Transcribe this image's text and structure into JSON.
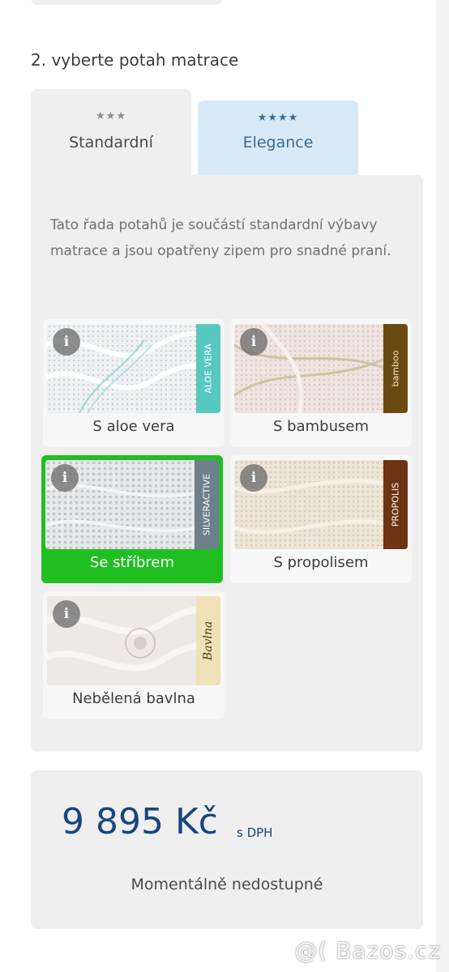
{
  "heading": "2. vyberte potah matrace",
  "tabs": [
    {
      "label": "Standardní",
      "stars": "★★★",
      "star_color": "#8b8b8b"
    },
    {
      "label": "Elegance",
      "stars": "★★★★",
      "star_color": "#3d6b90"
    }
  ],
  "description": "Tato řada potahů je součástí standardní výbavy matrace a jsou opatřeny zipem pro snadné praní.",
  "covers": [
    {
      "label": "S aloe vera",
      "brand": "ALOE VERA",
      "brand_color": "#57c9c0",
      "info": "i",
      "selected": false
    },
    {
      "label": "S bambusem",
      "brand": "bamboo",
      "brand_color": "#6b4a12",
      "info": "i",
      "selected": false
    },
    {
      "label": "Se stříbrem",
      "brand": "SILVERACTIVE",
      "brand_color": "#6e7f8c",
      "info": "i",
      "selected": true
    },
    {
      "label": "S propolisem",
      "brand": "PROPOLIS",
      "brand_color": "#6e3312",
      "info": "i",
      "selected": false
    },
    {
      "label": "Nebělená bavlna",
      "brand": "Bavlna",
      "brand_color": "#f1e1b8",
      "info": "i",
      "selected": false
    }
  ],
  "price": {
    "amount": "9 895 Kč",
    "note": "s DPH"
  },
  "availability": "Momentálně nedostupné",
  "watermark": "@( Bazos.cz",
  "colors": {
    "accent_green": "#1fbf22",
    "price_blue": "#17467c",
    "elegance_tab": "#d8eaf7"
  }
}
